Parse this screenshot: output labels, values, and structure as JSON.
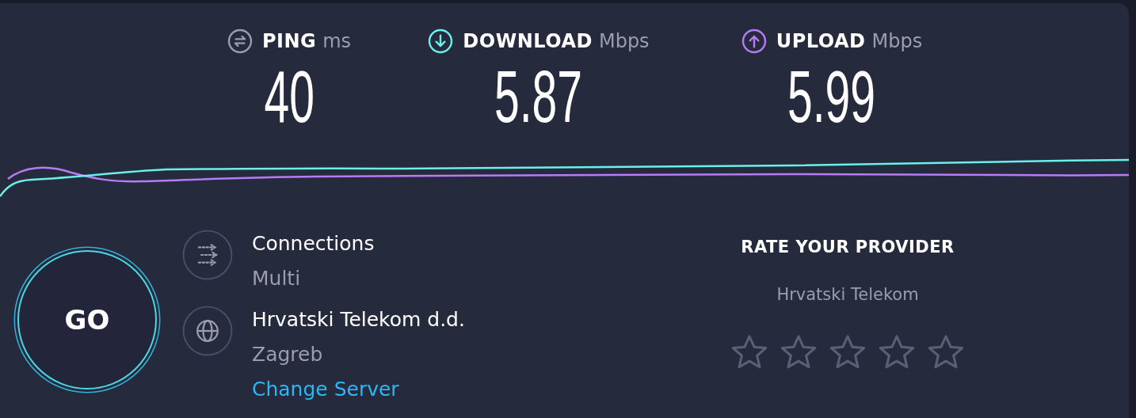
{
  "metrics": [
    {
      "kind": "ping",
      "label": "PING",
      "unit": "ms",
      "value": "40"
    },
    {
      "kind": "download",
      "label": "DOWNLOAD",
      "unit": "Mbps",
      "value": "5.87"
    },
    {
      "kind": "upload",
      "label": "UPLOAD",
      "unit": "Mbps",
      "value": "5.99"
    }
  ],
  "go_button": {
    "label": "GO"
  },
  "info": [
    {
      "kind": "connections",
      "title": "Connections",
      "detail": "Multi"
    },
    {
      "kind": "server",
      "title": "Hrvatski Telekom d.d.",
      "detail": "Zagreb",
      "link": "Change Server"
    }
  ],
  "rating": {
    "title": "RATE YOUR PROVIDER",
    "provider": "Hrvatski Telekom",
    "stars": 0
  }
}
